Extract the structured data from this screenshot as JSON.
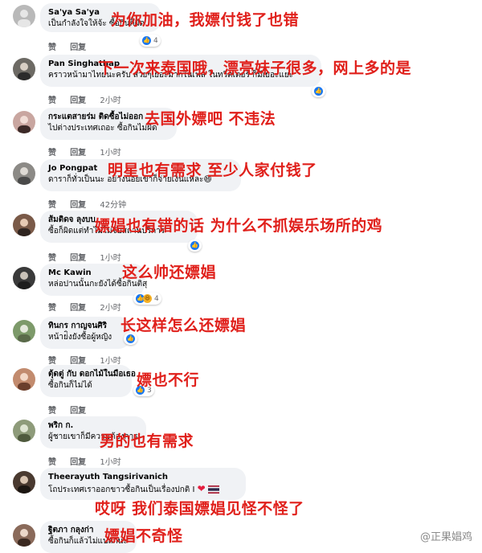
{
  "labels": {
    "like": "赞",
    "reply": "回复"
  },
  "comments": [
    {
      "author": "Sa'ya Sa'ya",
      "text": "เป็นกำลังใจให้จ้ะ ซื้อกินก็ผิด",
      "time": "",
      "reactions": "4",
      "overlay": "为你加油，我嫖付钱了也错",
      "avatar_color": "#b9b9b9"
    },
    {
      "author": "Pan Singhathap",
      "text": "คราวหน้ามาไทยนะครับ สวยๆเยอะมากในเฟส ในทวิตเตอร์ ก็มีเยอะแยะ",
      "time": "2小时",
      "reactions": "",
      "overlay": "下一次来泰国哦，漂亮妹子很多，网上多的是",
      "avatar_color": "#6d6a64"
    },
    {
      "author": "กระแตสายร่ม ติดซื้อไม่ออก",
      "text": "ไปต่างประเทศเถอะ ซื้อกินไม่ผิด",
      "time": "1小时",
      "reactions": "",
      "overlay": "去国外嫖吧 不违法",
      "avatar_color": "#c9a6a0"
    },
    {
      "author": "Jo Pongpat",
      "text": "ดาราก็ทั่วเป็นนะ อย่างน้อยเขาก็จ่ายเงินแหละ😄",
      "time": "42分钟",
      "reactions": "",
      "overlay": "明星也有需求 至少人家付钱了",
      "avatar_color": "#8c8a86"
    },
    {
      "author": "ส้มติดจ ลุงบบ",
      "text": "ซื้อก็ผิดแต่ทำไมไม่จับสถานบริการ",
      "time": "1小时",
      "reactions": "",
      "overlay": "嫖娼也有错的话 为什么不抓娱乐场所的鸡",
      "avatar_color": "#7a5a48"
    },
    {
      "author": "Mc Kawin",
      "text": "หล่อปานนั้นกะยังได้ซื้อกินติสุ",
      "time": "2小时",
      "reactions": "4",
      "overlay": "这么帅还嫖娼",
      "avatar_color": "#3a3a3a"
    },
    {
      "author": "ทินกร กาญจนศิริ",
      "text": "หน้าย่ิงยังซื้อผู้หญิง",
      "time": "1小时",
      "reactions": "",
      "overlay": "长这样怎么还嫖娼",
      "avatar_color": "#7d9a6a"
    },
    {
      "author": "ตุ้ดตู่ กับ ดอกไม้ในมือเธอ",
      "text": "ซื้อกินก็ไม่ได้",
      "time": "",
      "reactions": "3",
      "overlay": "嫖也不行",
      "avatar_color": "#c28b6e"
    },
    {
      "author": "พริก ก.",
      "text": "ผู้ชายเขาก็มีความต้องการ",
      "time": "1小时",
      "reactions": "",
      "overlay": "男的也有需求",
      "avatar_color": "#8e9b7a"
    },
    {
      "author": "Theerayuth Tangsirivanich",
      "text": "โถประเทศเราออกขาวซื้อกินเป็นเรื่องปกติ I",
      "time": "",
      "reactions": "",
      "overlay": "哎呀 我们泰国嫖娼见怪不怪了",
      "avatar_color": "#4a3a30"
    },
    {
      "author": "ฐิตภา กลุงก่า",
      "text": "ซื้อกินก็แล้วไม่แปลกนะ",
      "time": "",
      "reactions": "",
      "overlay": "嫖娼不奇怪",
      "avatar_color": "#8a6a5a"
    }
  ],
  "watermark": "@正果娼鸡"
}
